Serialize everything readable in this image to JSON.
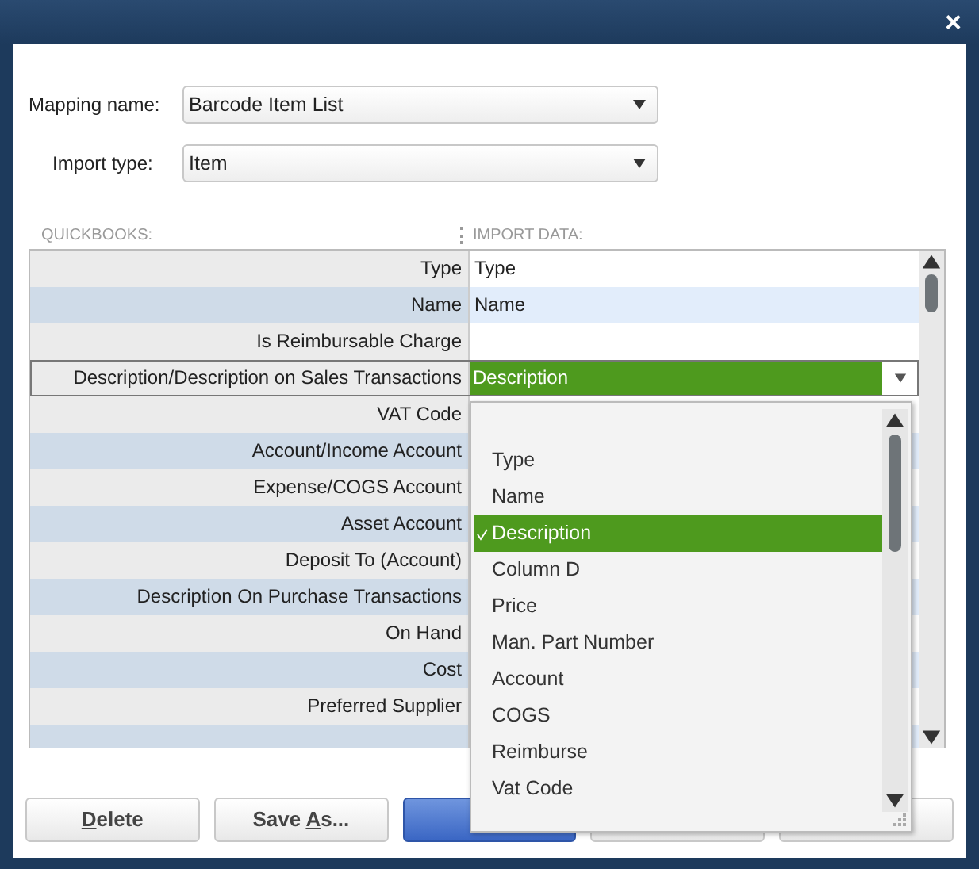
{
  "window": {
    "close_glyph": "×"
  },
  "mapping": {
    "label": "Mapping name:",
    "value": "Barcode Item List"
  },
  "import_type": {
    "label": "Import type:",
    "value": "Item"
  },
  "table": {
    "columns": [
      "QUICKBOOKS:",
      "IMPORT DATA:"
    ],
    "rows": [
      {
        "field": "Type",
        "value": "Type",
        "selected": false
      },
      {
        "field": "Name",
        "value": "Name",
        "selected": false
      },
      {
        "field": "Is Reimbursable Charge",
        "selected": false
      },
      {
        "field": "Description/Description on Sales Transactions",
        "value": "Description",
        "selected": true
      },
      {
        "field": "VAT Code",
        "selected": false
      },
      {
        "field": "Account/Income Account",
        "selected": false
      },
      {
        "field": "Expense/COGS Account",
        "selected": false
      },
      {
        "field": "Asset Account",
        "selected": false
      },
      {
        "field": "Deposit To (Account)",
        "selected": false
      },
      {
        "field": "Description On Purchase Transactions",
        "selected": false
      },
      {
        "field": "On Hand",
        "selected": false
      },
      {
        "field": "Cost",
        "selected": false
      },
      {
        "field": "Preferred Supplier",
        "selected": false
      },
      {
        "selected": false
      }
    ]
  },
  "dropdown": {
    "options": [
      {
        "label": "Type",
        "selected": false
      },
      {
        "label": "Name",
        "selected": false
      },
      {
        "label": "Description",
        "selected": true
      },
      {
        "label": "Column D",
        "selected": false
      },
      {
        "label": "Price",
        "selected": false
      },
      {
        "label": "Man. Part Number",
        "selected": false
      },
      {
        "label": "Account",
        "selected": false
      },
      {
        "label": "COGS",
        "selected": false
      },
      {
        "label": "Reimburse",
        "selected": false
      },
      {
        "label": "Vat Code",
        "selected": false
      }
    ]
  },
  "buttons": [
    {
      "kind": "plain",
      "label": {
        "key": "D",
        "after": "elete"
      }
    },
    {
      "kind": "plain",
      "label": {
        "before": "Save ",
        "key": "A",
        "after": "s..."
      }
    },
    {
      "kind": "primary"
    },
    {
      "kind": "plain"
    },
    {
      "kind": "plain"
    }
  ]
}
